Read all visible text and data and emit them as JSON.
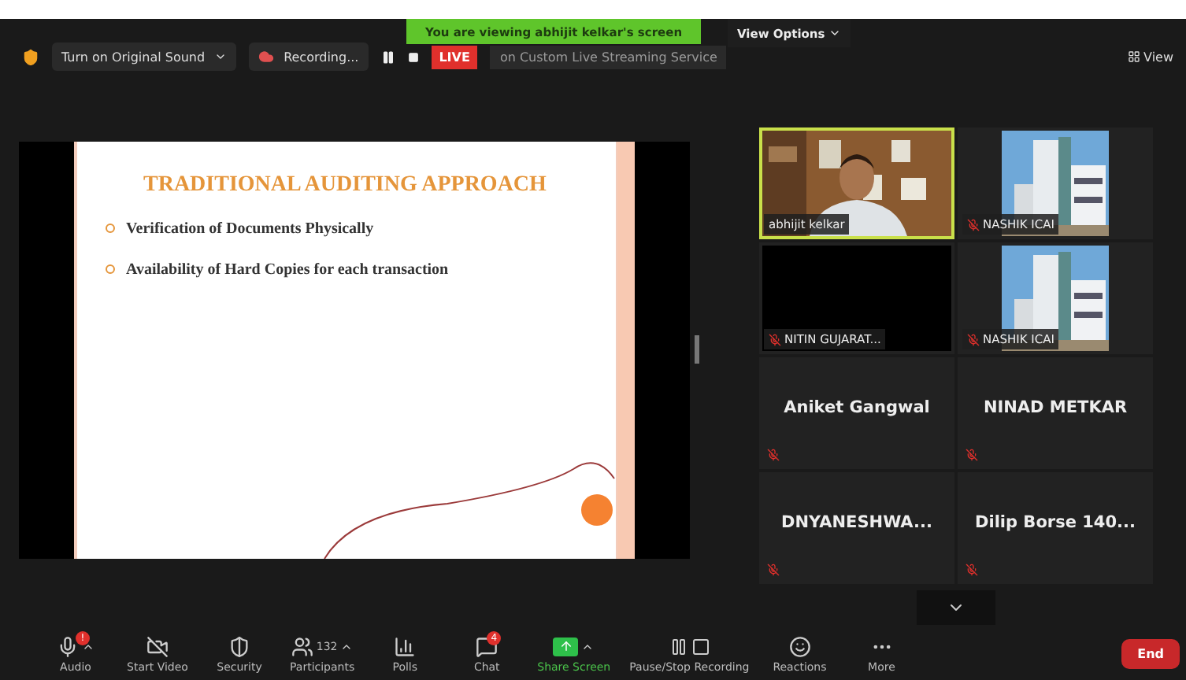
{
  "top_bar": {
    "shield": true,
    "original_sound": "Turn on Original Sound",
    "recording": "Recording...",
    "live_badge": "LIVE",
    "live_service": "on Custom Live Streaming Service",
    "view_options": "View Options",
    "view": "View"
  },
  "banner": "You are viewing abhijit kelkar's screen",
  "slide": {
    "title": "TRADITIONAL AUDITING APPROACH",
    "bullets": [
      "Verification of Documents Physically",
      "Availability of Hard Copies for each transaction"
    ]
  },
  "gallery": [
    {
      "name": "abhijit kelkar",
      "kind": "person_video",
      "speaking": true,
      "muted": false
    },
    {
      "name": "NASHIK ICAI",
      "kind": "building_video",
      "speaking": false,
      "muted": true
    },
    {
      "name": "NITIN GUJARAT...",
      "kind": "no_video",
      "speaking": false,
      "muted": true
    },
    {
      "name": "NASHIK ICAI",
      "kind": "building_video",
      "speaking": false,
      "muted": true
    },
    {
      "name": "Aniket Gangwal",
      "kind": "name_only",
      "speaking": false,
      "muted": true
    },
    {
      "name": "NINAD METKAR",
      "kind": "name_only",
      "speaking": false,
      "muted": true
    },
    {
      "name": "DNYANESHWA...",
      "kind": "name_only",
      "speaking": false,
      "muted": true
    },
    {
      "name": "Dilip  Borse 140...",
      "kind": "name_only",
      "speaking": false,
      "muted": true
    }
  ],
  "toolbar": [
    {
      "kind": "audio",
      "label": "Audio",
      "menu": true,
      "badge": "!",
      "active": false
    },
    {
      "kind": "video",
      "label": "Start Video",
      "menu": false,
      "active": false
    },
    {
      "kind": "security",
      "label": "Security",
      "menu": false,
      "active": false
    },
    {
      "kind": "participants",
      "label": "Participants",
      "count": "132",
      "menu": true,
      "active": false
    },
    {
      "kind": "polls",
      "label": "Polls",
      "menu": false,
      "active": false
    },
    {
      "kind": "chat",
      "label": "Chat",
      "badge": "4",
      "menu": false,
      "active": false
    },
    {
      "kind": "share",
      "label": "Share Screen",
      "menu": true,
      "active": true
    },
    {
      "kind": "recording",
      "label": "Pause/Stop Recording",
      "menu": false,
      "active": false
    },
    {
      "kind": "reactions",
      "label": "Reactions",
      "menu": false,
      "active": false
    },
    {
      "kind": "more",
      "label": "More",
      "menu": false,
      "active": false
    }
  ],
  "end_button": "End"
}
